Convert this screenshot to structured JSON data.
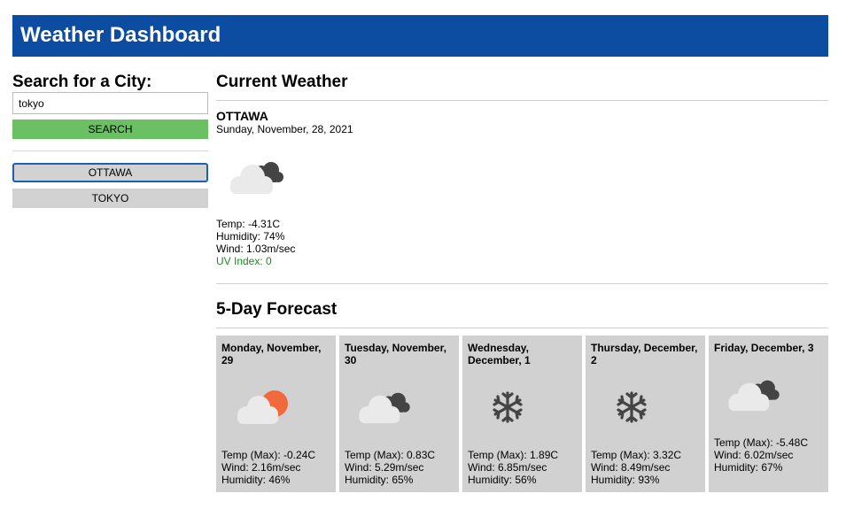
{
  "header": {
    "title": "Weather Dashboard"
  },
  "search": {
    "heading": "Search for a City:",
    "input_value": "tokyo",
    "button_label": "SEARCH"
  },
  "history": [
    {
      "label": "OTTAWA",
      "active": true
    },
    {
      "label": "TOKYO",
      "active": false
    }
  ],
  "current": {
    "section_title": "Current Weather",
    "city": "OTTAWA",
    "date": "Sunday, November, 28, 2021",
    "icon": "cloudy-icon",
    "temp": "Temp: -4.31C",
    "humidity": "Humidity: 74%",
    "wind": "Wind: 1.03m/sec",
    "uv": "UV Index: 0",
    "uv_color": "#1b8a1b"
  },
  "forecast": {
    "section_title": "5-Day Forecast",
    "days": [
      {
        "date": "Monday, November, 29",
        "icon": "partly-cloudy-icon",
        "temp": "Temp (Max): -0.24C",
        "wind": "Wind: 2.16m/sec",
        "humidity": "Humidity: 46%"
      },
      {
        "date": "Tuesday, November, 30",
        "icon": "cloudy-icon",
        "temp": "Temp (Max): 0.83C",
        "wind": "Wind: 5.29m/sec",
        "humidity": "Humidity: 65%"
      },
      {
        "date": "Wednesday, December, 1",
        "icon": "snow-icon",
        "temp": "Temp (Max): 1.89C",
        "wind": "Wind: 6.85m/sec",
        "humidity": "Humidity: 56%"
      },
      {
        "date": "Thursday, December, 2",
        "icon": "snow-icon",
        "temp": "Temp (Max): 3.32C",
        "wind": "Wind: 8.49m/sec",
        "humidity": "Humidity: 93%"
      },
      {
        "date": "Friday, December, 3",
        "icon": "cloudy-icon",
        "temp": "Temp (Max): -5.48C",
        "wind": "Wind: 6.02m/sec",
        "humidity": "Humidity: 67%"
      }
    ]
  },
  "colors": {
    "header": "#0c4da2",
    "search_button": "#6ac062",
    "history_button": "#d2d2d2",
    "card": "#d1d1d1",
    "sun": "#f06a3c"
  }
}
